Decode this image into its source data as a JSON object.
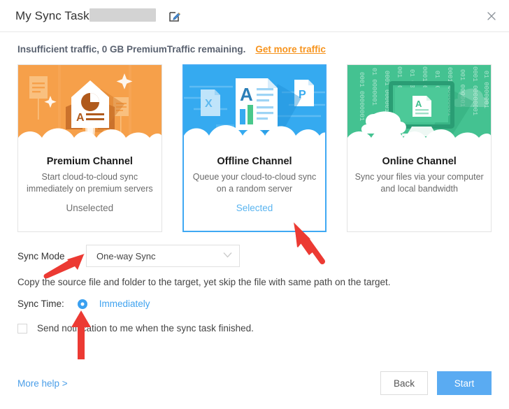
{
  "titlebar": {
    "title": "My Sync Task",
    "redacted_name": "",
    "edit_icon": "edit-pencil-icon",
    "close_icon": "close-icon"
  },
  "banner": {
    "message": "Insufficient traffic, 0 GB PremiumTraffic remaining.",
    "link_label": "Get more traffic",
    "link_color": "#f7941e",
    "text_color": "#5a6270"
  },
  "channels": [
    {
      "id": "premium",
      "title": "Premium Channel",
      "description": "Start cloud-to-cloud sync immediately on premium servers",
      "state_label": "Unselected",
      "selected": false,
      "art": "rocket-document-icon",
      "accent": "#f59b43"
    },
    {
      "id": "offline",
      "title": "Offline Channel",
      "description": "Queue your cloud-to-cloud sync on a random server",
      "state_label": "Selected",
      "selected": true,
      "art": "documents-word-excel-powerpoint-icon",
      "accent": "#35aaf0"
    },
    {
      "id": "online",
      "title": "Online Channel",
      "description": "Sync your files via your computer and local bandwidth",
      "state_label": "",
      "selected": false,
      "art": "monitor-cloud-binary-icon",
      "accent": "#3fc191"
    }
  ],
  "form": {
    "sync_mode_label": "Sync Mode",
    "sync_mode_value": "One-way Sync",
    "sync_mode_chevron": "chevron-down-icon",
    "sync_mode_hint": "Copy the source file and folder to the target, yet skip the file with same path on the target.",
    "sync_time_label": "Sync Time:",
    "sync_time_value": "Immediately",
    "notify_checkbox_label": "Send notification to me when the sync task finished.",
    "notify_checked": false
  },
  "footer": {
    "more_help_label": "More help >",
    "back_label": "Back",
    "start_label": "Start",
    "primary_color": "#5aabf2"
  },
  "annotations": {
    "arrow_color": "#ec3a33",
    "arrows": [
      {
        "name": "arrow-pointing-offline-channel"
      },
      {
        "name": "arrow-pointing-sync-mode"
      },
      {
        "name": "arrow-pointing-sync-time-radio"
      }
    ]
  }
}
